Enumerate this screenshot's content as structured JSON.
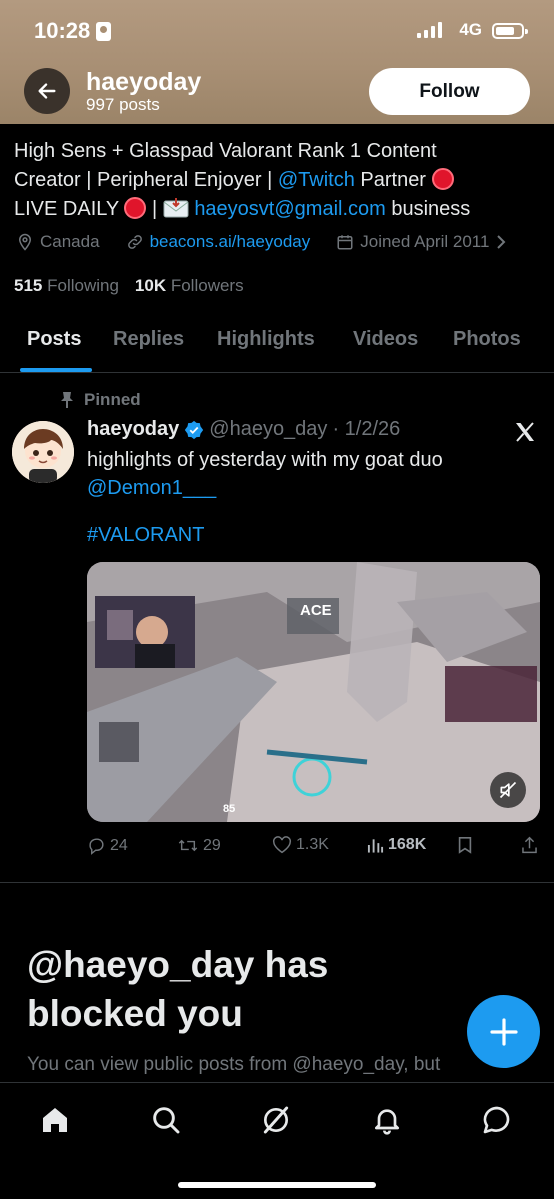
{
  "status_bar": {
    "time": "10:28",
    "network": "4G"
  },
  "header": {
    "name": "haeyoday",
    "posts_count": "997 posts",
    "follow_label": "Follow"
  },
  "bio": {
    "line1": "High Sens + Glasspad Valorant Rank 1 Content",
    "line2_a": "Creator | Peripheral Enjoyer | ",
    "line2_link": "@Twitch",
    "line2_b": " Partner",
    "line3_a": "LIVE DAILY",
    "line3_sep": " | ",
    "line3_email": "haeyosvt@gmail.com",
    "line3_b": " business"
  },
  "meta": {
    "location": "Canada",
    "website": "beacons.ai/haeyoday",
    "joined": "Joined April 2011"
  },
  "counts": {
    "following_num": "515",
    "following_label": "Following",
    "followers_num": "10K",
    "followers_label": "Followers"
  },
  "tabs": [
    "Posts",
    "Replies",
    "Highlights",
    "Videos",
    "Photos"
  ],
  "tweet": {
    "pinned_label": "Pinned",
    "name": "haeyoday",
    "handle": "@haeyo_day",
    "date": "· 1/2/26",
    "text": "highlights of yesterday with my goat duo",
    "mention": "@Demon1___",
    "hashtag": "#VALORANT",
    "media_overlay": "ACE",
    "media_ammo": "85",
    "replies": "24",
    "reposts": "29",
    "likes": "1.3K",
    "views": "168K"
  },
  "blocked": {
    "title": "@haeyo_day has blocked you",
    "subtitle": "You can view public posts from @haeyo_day, but"
  },
  "colors": {
    "accent": "#1d9bf0",
    "banner": "#a88f74",
    "muted": "#71767b"
  }
}
